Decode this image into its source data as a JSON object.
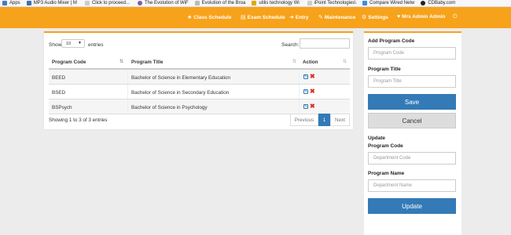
{
  "bookmarks": [
    {
      "label": "Apps",
      "color": "#4a78c8"
    },
    {
      "label": "MP3 Audio Mixer | M",
      "color": "#3d6fb8"
    },
    {
      "label": "Click to proceed...",
      "color": "#cccccc"
    },
    {
      "label": "The Evolution of WiF",
      "color": "#7b5ea7"
    },
    {
      "label": "Evolution of the Broa",
      "color": "#bbbbbb"
    },
    {
      "label": "utilis technology Wi",
      "color": "#e0a800"
    },
    {
      "label": "iPoint Technologies\\",
      "color": "#cccccc"
    },
    {
      "label": "Compare Wired Netw",
      "color": "#3b8edc"
    },
    {
      "label": "CDBaby.com",
      "color": "#222222"
    }
  ],
  "navbar": {
    "items": [
      {
        "icon": "star-icon",
        "label": "Class Schedule"
      },
      {
        "icon": "list-icon",
        "label": "Exam Schedule"
      },
      {
        "icon": "entry-icon",
        "label": "Entry"
      },
      {
        "icon": "wrench-icon",
        "label": "Maintenance"
      },
      {
        "icon": "gear-icon",
        "label": "Settings"
      },
      {
        "icon": "user-icon",
        "label": "Mrs Admin Admin"
      },
      {
        "icon": "power-icon",
        "label": ""
      }
    ]
  },
  "table_controls": {
    "show_label": "Show",
    "page_size": "10",
    "entries_label": "entries",
    "search_label": "Search:"
  },
  "table": {
    "columns": [
      "Program Code",
      "Program Title",
      "Action"
    ],
    "rows": [
      {
        "code": "BEED",
        "title": "Bachelor of Science in Elementary Education"
      },
      {
        "code": "BSED",
        "title": "Bachelor of Science in Secondary Education"
      },
      {
        "code": "BSPsych",
        "title": "Bachelor of Science in Psychology"
      }
    ],
    "info": "Showing 1 to 3 of 3 entries",
    "pager": {
      "previous": "Previous",
      "current": "1",
      "next": "Next"
    }
  },
  "form": {
    "add_code_label": "Add Program Code",
    "add_code_placeholder": "Program Code",
    "title_label": "Program Title",
    "title_placeholder": "Program Title",
    "save_label": "Save",
    "cancel_label": "Cancel",
    "update_heading": "Update",
    "upd_code_label": "Program Code",
    "upd_code_placeholder": "Department Code",
    "upd_name_label": "Program Name",
    "upd_name_placeholder": "Department Name",
    "update_label": "Update"
  },
  "colors": {
    "accent": "#f7a21b",
    "primary": "#337ab7",
    "danger": "#d9302a"
  }
}
